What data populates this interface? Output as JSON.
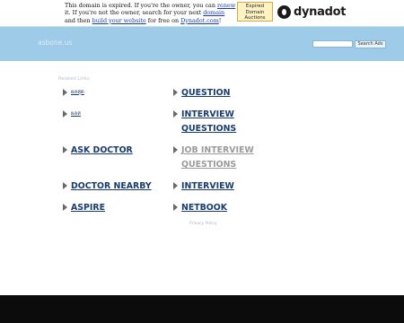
{
  "expiry": {
    "line1_a": "This domain is expired. If you're the owner, you can ",
    "renew": "renew",
    "line2_a": "it. If you're not the owner, search for your next ",
    "domain": "domain",
    "line3_a": "and then ",
    "build": "build your website",
    "line3_b": " for free on ",
    "dynadot": "Dynadot.com",
    "line3_c": "!"
  },
  "auction_button": {
    "l1": "Expired",
    "l2": "Domain",
    "l3": "Auctions"
  },
  "logo": {
    "text": "dynadot"
  },
  "header": {
    "site_name": "asbone.us",
    "search_button": "Search Ads",
    "search_placeholder": ""
  },
  "related": {
    "title": "Related Links"
  },
  "links": [
    {
      "label": "ผลสุด",
      "col": "left",
      "style": "small"
    },
    {
      "label": "QUESTION",
      "col": "right"
    },
    {
      "label": "ผลส",
      "col": "left",
      "style": "small"
    },
    {
      "label": "INTERVIEW QUESTIONS",
      "col": "right",
      "line1": "INTERVIEW",
      "line2": "QUESTIONS"
    },
    {
      "label": "ASK DOCTOR",
      "col": "left"
    },
    {
      "label": "JOB INTERVIEW QUESTIONS",
      "col": "right",
      "line1": "JOB INTERVIEW",
      "line2": "QUESTIONS"
    },
    {
      "label": "DOCTOR NEARBY",
      "col": "left"
    },
    {
      "label": "INTERVIEW",
      "col": "right"
    },
    {
      "label": "ASPIRE",
      "col": "left"
    },
    {
      "label": "NETBOOK",
      "col": "right"
    }
  ],
  "privacy": "Privacy Policy"
}
